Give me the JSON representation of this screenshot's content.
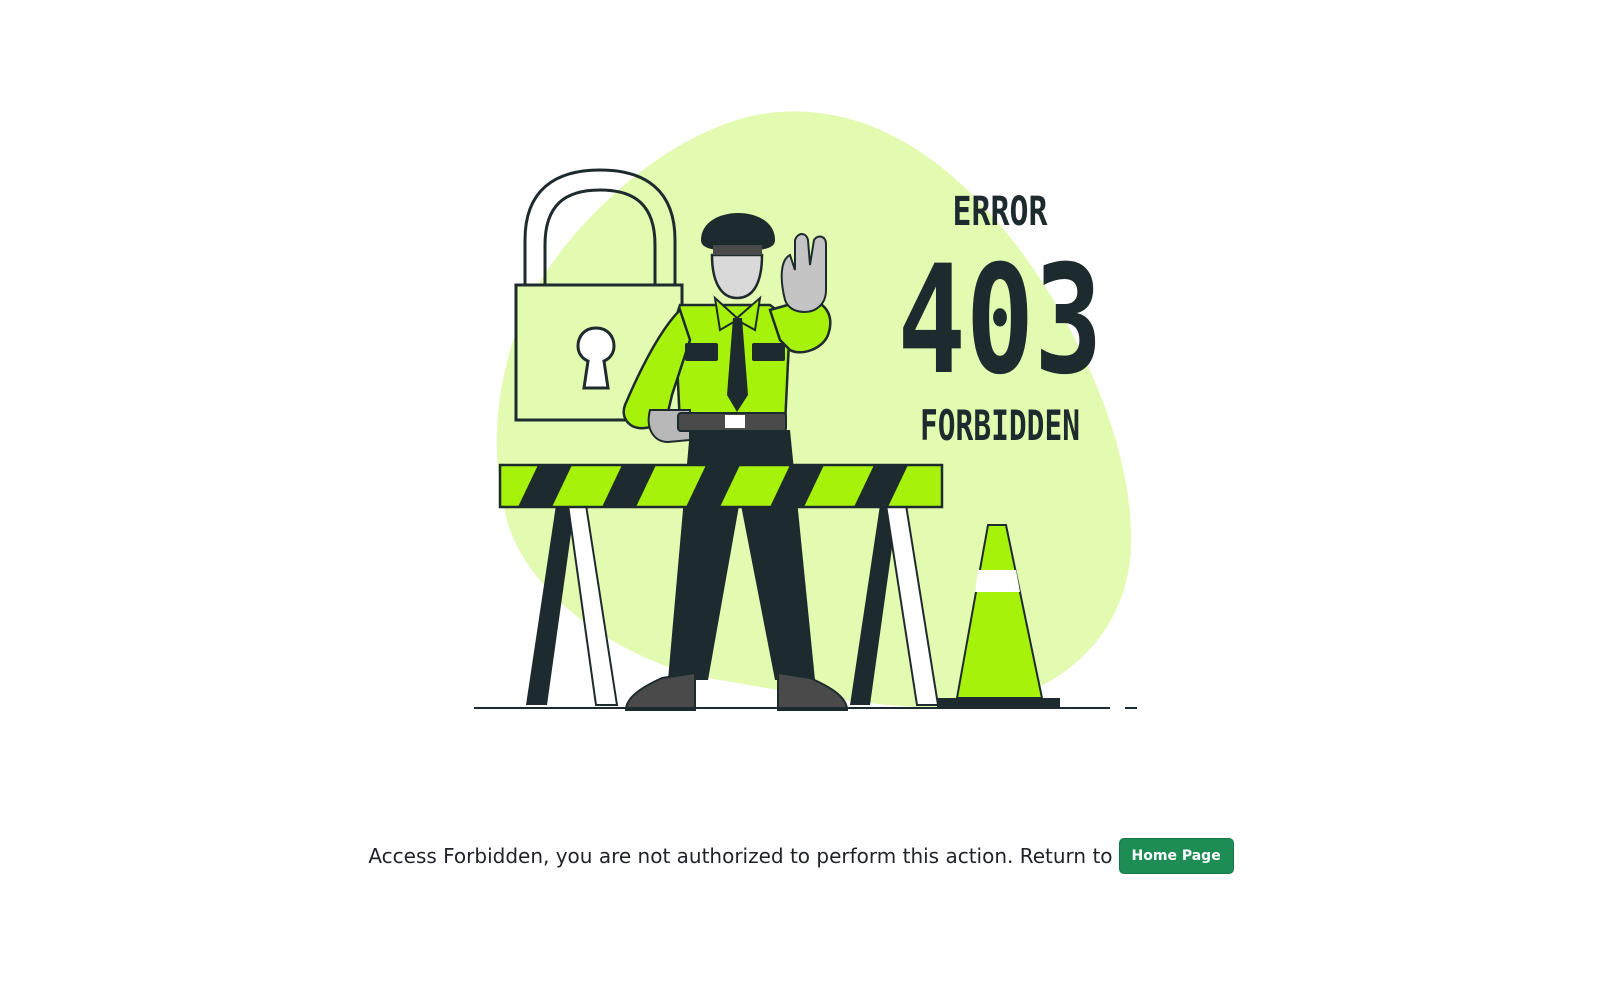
{
  "illustration": {
    "error_label": "ERROR",
    "code": "403",
    "status_label": "FORBIDDEN"
  },
  "message": {
    "text": "Access Forbidden, you are not authorized to perform this action. Return to",
    "button_label": "Home Page"
  },
  "colors": {
    "accent_green": "#1e8c55",
    "lime": "#a6f20b",
    "pale_lime": "#e3fab1",
    "dark": "#1e2b2e"
  }
}
